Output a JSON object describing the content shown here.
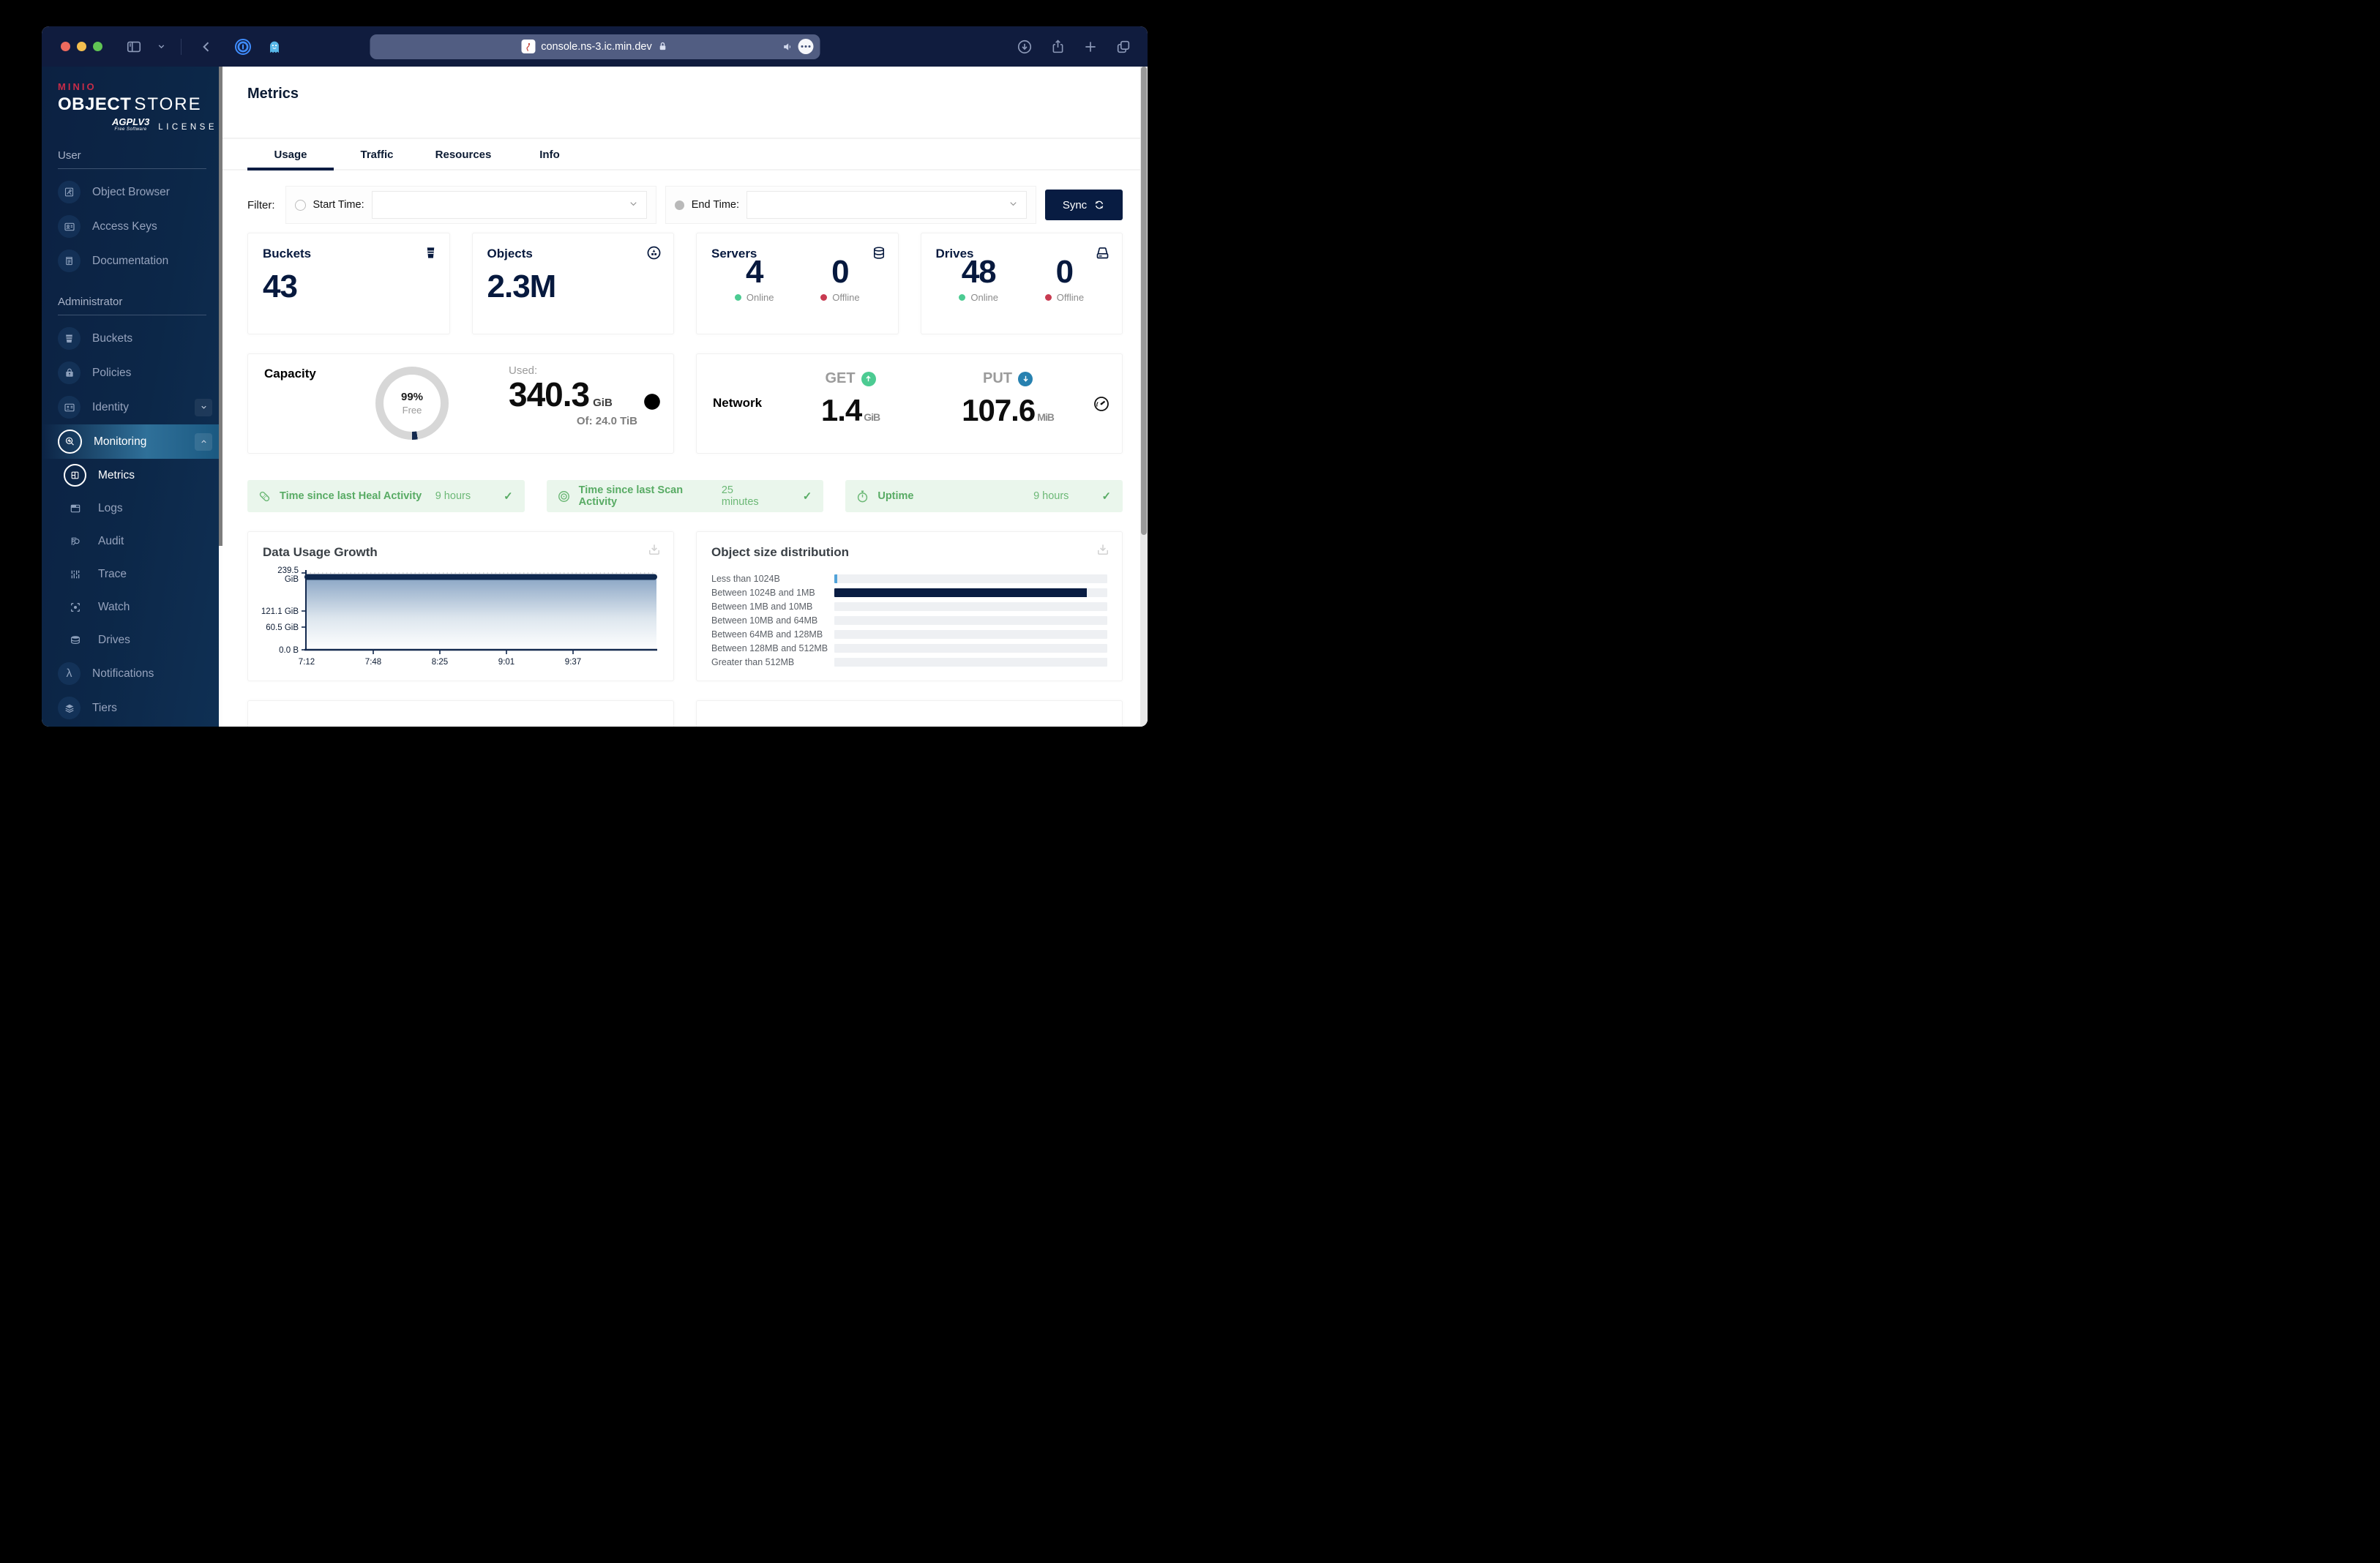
{
  "browser": {
    "url": "console.ns-3.ic.min.dev"
  },
  "sidebar": {
    "logo": {
      "brand": "MINIO",
      "title_bold": "OBJECT",
      "title_light": "STORE",
      "license_badge": "AGPLV3",
      "license_sub": "Free Software",
      "license_word": "LICENSE"
    },
    "user_section": {
      "title": "User",
      "items": [
        {
          "label": "Object Browser"
        },
        {
          "label": "Access Keys"
        },
        {
          "label": "Documentation"
        }
      ]
    },
    "admin_section": {
      "title": "Administrator",
      "items": [
        {
          "label": "Buckets"
        },
        {
          "label": "Policies"
        },
        {
          "label": "Identity"
        },
        {
          "label": "Monitoring"
        }
      ]
    },
    "monitoring_children": [
      {
        "label": "Metrics"
      },
      {
        "label": "Logs"
      },
      {
        "label": "Audit"
      },
      {
        "label": "Trace"
      },
      {
        "label": "Watch"
      },
      {
        "label": "Drives"
      }
    ],
    "bottom_items": [
      {
        "label": "Notifications"
      },
      {
        "label": "Tiers"
      }
    ]
  },
  "main": {
    "title": "Metrics",
    "tabs": [
      {
        "label": "Usage"
      },
      {
        "label": "Traffic"
      },
      {
        "label": "Resources"
      },
      {
        "label": "Info"
      }
    ],
    "filter": {
      "label": "Filter:",
      "start_label": "Start Time:",
      "end_label": "End Time:",
      "sync_label": "Sync"
    },
    "stats": {
      "buckets": {
        "title": "Buckets",
        "value": "43"
      },
      "objects": {
        "title": "Objects",
        "value": "2.3M"
      },
      "servers": {
        "title": "Servers",
        "online_value": "4",
        "offline_value": "0",
        "online_label": "Online",
        "offline_label": "Offline"
      },
      "drives": {
        "title": "Drives",
        "online_value": "48",
        "offline_value": "0",
        "online_label": "Online",
        "offline_label": "Offline"
      }
    },
    "capacity": {
      "title": "Capacity",
      "free_pct": "99%",
      "free_label": "Free",
      "used_label": "Used:",
      "used_value": "340.3",
      "used_unit": "GiB",
      "total_label": "Of: 24.0 TiB"
    },
    "network": {
      "title": "Network",
      "get_label": "GET",
      "get_value": "1.4",
      "get_unit": "GiB",
      "put_label": "PUT",
      "put_value": "107.6",
      "put_unit": "MiB"
    },
    "status_bars": [
      {
        "label": "Time since last Heal Activity",
        "value": "9 hours"
      },
      {
        "label": "Time since last Scan Activity",
        "value": "25 minutes"
      },
      {
        "label": "Uptime",
        "value": "9 hours"
      }
    ],
    "usage_chart": {
      "title": "Data Usage Growth",
      "y_tick_0a": "239.5",
      "y_tick_0b": "GiB",
      "y_tick_1": "121.1 GiB",
      "y_tick_2": "60.5 GiB",
      "y_tick_3": "0.0 B",
      "x_ticks": [
        "7:12",
        "7:48",
        "8:25",
        "9:01",
        "9:37"
      ]
    },
    "distribution": {
      "title": "Object size distribution",
      "rows": [
        {
          "label": "Less than 1024B",
          "pct": 1
        },
        {
          "label": "Between 1024B and 1MB",
          "pct": 92.4
        },
        {
          "label": "Between 1MB and 10MB",
          "pct": 0
        },
        {
          "label": "Between 10MB and 64MB",
          "pct": 0
        },
        {
          "label": "Between 64MB and 128MB",
          "pct": 0
        },
        {
          "label": "Between 128MB and 512MB",
          "pct": 0
        },
        {
          "label": "Greater than 512MB",
          "pct": 0
        }
      ]
    }
  },
  "colors": {
    "navy": "#081C42",
    "green": "#4CCB92",
    "red": "#C83B51",
    "mint_bg": "#EAF6EC",
    "mint_text": "#58AB64",
    "blue": "#2781B0",
    "bar_blue": "#52A3D9"
  },
  "chart_data": [
    {
      "type": "area",
      "title": "Data Usage Growth",
      "x": [
        "7:12",
        "7:48",
        "8:25",
        "9:01",
        "9:37"
      ],
      "series": [
        {
          "name": "Data Usage",
          "values": [
            218,
            218,
            218,
            218,
            218
          ]
        }
      ],
      "ylabel": "GiB",
      "ylim": [
        0,
        239.5
      ],
      "y_ticks": [
        "239.5 GiB",
        "121.1 GiB",
        "60.5 GiB",
        "0.0 B"
      ],
      "grid": "dotted-horizontal",
      "legend": false
    },
    {
      "type": "bar",
      "orientation": "horizontal",
      "title": "Object size distribution",
      "categories": [
        "Less than 1024B",
        "Between 1024B and 1MB",
        "Between 1MB and 10MB",
        "Between 10MB and 64MB",
        "Between 64MB and 128MB",
        "Between 128MB and 512MB",
        "Greater than 512MB"
      ],
      "values_pct_of_track": [
        1,
        92.4,
        0,
        0,
        0,
        0,
        0
      ],
      "bar_colors": [
        "#52A3D9",
        "#081C42",
        "none",
        "none",
        "none",
        "none",
        "none"
      ]
    }
  ]
}
